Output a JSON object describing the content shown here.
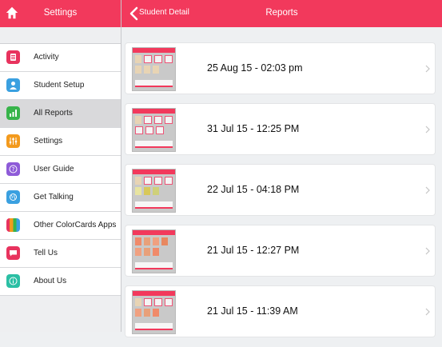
{
  "sidebar": {
    "title": "Settings",
    "items": [
      {
        "label": "Activity",
        "icon": "activity-icon",
        "color": "#e8335e"
      },
      {
        "label": "Student Setup",
        "icon": "student-icon",
        "color": "#3aa0e0"
      },
      {
        "label": "All Reports",
        "icon": "reports-icon",
        "color": "#37b44a"
      },
      {
        "label": "Settings",
        "icon": "settings-icon",
        "color": "#f39a1d"
      },
      {
        "label": "User Guide",
        "icon": "question-icon",
        "color": "#8e5bd8"
      },
      {
        "label": "Get Talking",
        "icon": "globe-icon",
        "color": "#3aa0e0"
      },
      {
        "label": "Other ColorCards Apps",
        "icon": "apps-icon",
        "color": "#e8335e"
      },
      {
        "label": "Tell Us",
        "icon": "chat-icon",
        "color": "#e8335e"
      },
      {
        "label": "About Us",
        "icon": "info-icon",
        "color": "#2bbfa4"
      }
    ],
    "active_index": 2
  },
  "header": {
    "back_label": "Student Detail",
    "title": "Reports"
  },
  "reports": [
    {
      "date": "25 Aug 15 - 02:03 pm"
    },
    {
      "date": "31 Jul 15 - 12:25 PM"
    },
    {
      "date": "22 Jul 15 - 04:18 PM"
    },
    {
      "date": "21 Jul 15 - 12:27 PM"
    },
    {
      "date": "21 Jul 15 - 11:39 AM"
    }
  ],
  "colors": {
    "accent": "#f2395c"
  }
}
